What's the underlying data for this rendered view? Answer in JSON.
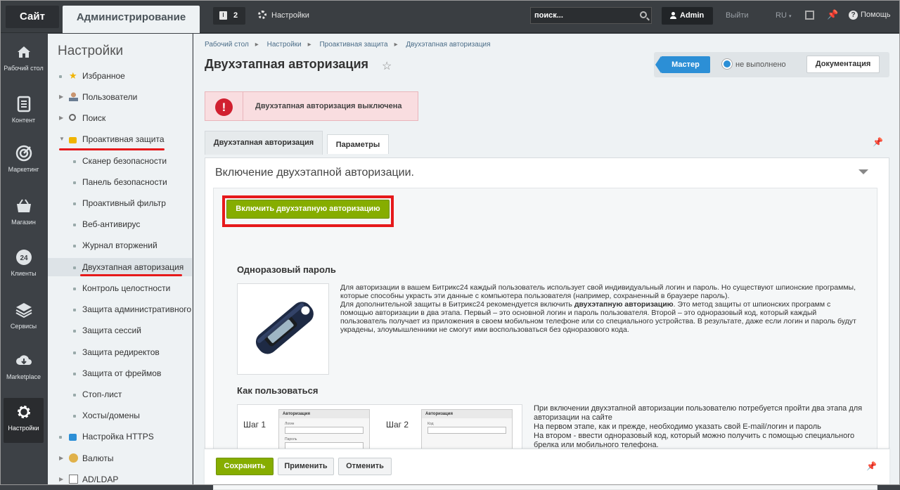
{
  "topbar": {
    "site_tab": "Сайт",
    "admin_tab": "Администрирование",
    "notifications_count": "2",
    "settings_label": "Настройки",
    "search_placeholder": "поиск...",
    "user_name": "Admin",
    "logout_label": "Выйти",
    "language": "RU",
    "help_label": "Помощь"
  },
  "iconbar": {
    "items": [
      {
        "label": "Рабочий стол",
        "icon": "home-icon"
      },
      {
        "label": "Контент",
        "icon": "document-icon"
      },
      {
        "label": "Маркетинг",
        "icon": "target-icon"
      },
      {
        "label": "Магазин",
        "icon": "basket-icon"
      },
      {
        "label": "Клиенты",
        "icon": "clients-24-icon",
        "badge": "24"
      },
      {
        "label": "Сервисы",
        "icon": "layers-icon"
      },
      {
        "label": "Marketplace",
        "icon": "cloud-download-icon"
      },
      {
        "label": "Настройки",
        "icon": "gear-icon"
      }
    ]
  },
  "menu": {
    "title": "Настройки",
    "items": [
      {
        "label": "Избранное"
      },
      {
        "label": "Пользователи"
      },
      {
        "label": "Поиск"
      },
      {
        "label": "Проактивная защита"
      },
      {
        "label": "Сканер безопасности"
      },
      {
        "label": "Панель безопасности"
      },
      {
        "label": "Проактивный фильтр"
      },
      {
        "label": "Веб-антивирус"
      },
      {
        "label": "Журнал вторжений"
      },
      {
        "label": "Двухэтапная авторизация"
      },
      {
        "label": "Контроль целостности"
      },
      {
        "label": "Защита административного раздела"
      },
      {
        "label": "Защита сессий"
      },
      {
        "label": "Защита редиректов"
      },
      {
        "label": "Защита от фреймов"
      },
      {
        "label": "Стоп-лист"
      },
      {
        "label": "Хосты/домены"
      },
      {
        "label": "Настройка HTTPS"
      },
      {
        "label": "Валюты"
      },
      {
        "label": "AD/LDAP"
      }
    ]
  },
  "breadcrumbs": [
    "Рабочий стол",
    "Настройки",
    "Проактивная защита",
    "Двухэтапная авторизация"
  ],
  "page_title": "Двухэтапная авторизация",
  "wizard": {
    "master_label": "Мастер",
    "status_label": "не выполнено",
    "docs_label": "Документация"
  },
  "alert_text": "Двухэтапная авторизация выключена",
  "tabs": [
    "Двухэтапная авторизация",
    "Параметры"
  ],
  "panel": {
    "title": "Включение двухэтапной авторизации.",
    "enable_button": "Включить двухэтапную авторизацию",
    "otp_title": "Одноразовый пароль",
    "otp_text_1": "Для авторизации в вашем Битрикс24 каждый пользователь использует свой индивидуальный логин и пароль. Но существуют шпионские программы, которые способны украсть эти данные с компьютера пользователя (например, сохраненный в браузере пароль).",
    "otp_text_2a": "Для дополнительной защиты в Битрикс24 рекомендуется включить ",
    "otp_text_2b": "двухэтапную авторизацию",
    "otp_text_2c": ". Это метод защиты от шпионских программ с помощью авторизации в два этапа. Первый – это основной логин и пароль пользователя. Второй – это одноразовый код, который каждый пользователь получает из приложения в своем мобильном телефоне или со специального устройства. В результате, даже если логин и пароль будут украдены, злоумышленники не смогут ими воспользоваться без одноразового кода.",
    "howto_title": "Как пользоваться",
    "step1": "Шаг 1",
    "step2": "Шаг 2",
    "form_header": "Авторизация",
    "form_login": "Логин",
    "form_password": "Пароль",
    "form_code": "Код",
    "howto_text_1": "При включении двухэтапной авторизации пользователю потребуется пройти два этапа для авторизации на сайте",
    "howto_text_2": "На первом этапе, как и прежде, необходимо указать свой E-mail/логин и пароль",
    "howto_text_3": "На втором - ввести одноразовый код, который можно получить с помощью специального брелка или мобильного телефона."
  },
  "footer": {
    "save": "Сохранить",
    "apply": "Применить",
    "cancel": "Отменить"
  },
  "colors": {
    "accent_green": "#86ad00",
    "accent_blue": "#2c8fd6",
    "alert_red": "#d12030",
    "highlight_red": "#e6191b"
  }
}
